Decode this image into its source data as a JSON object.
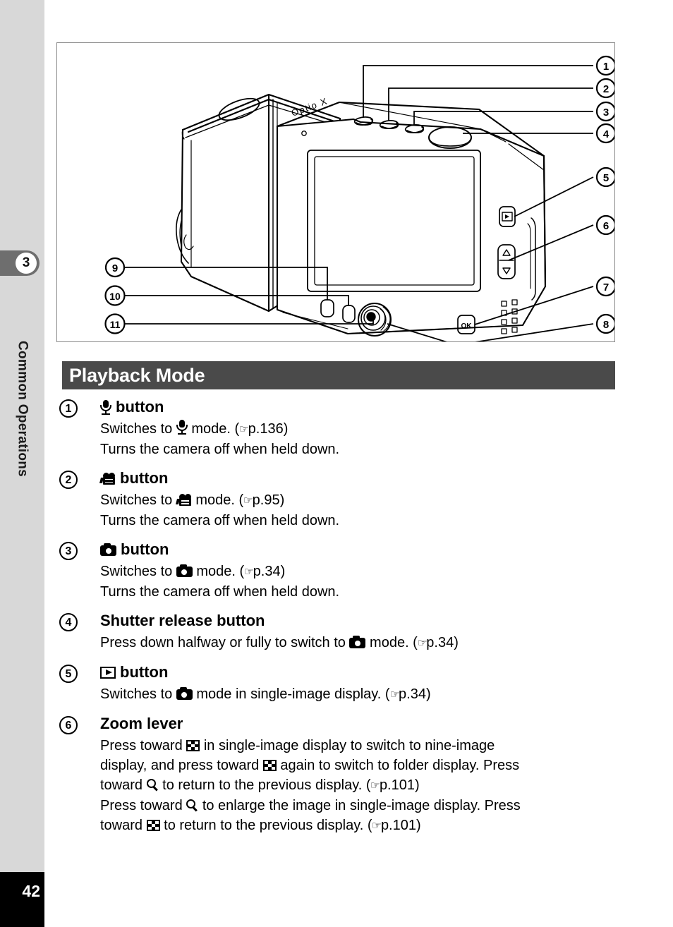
{
  "sidebar": {
    "chapter_number": "3",
    "chapter_title": "Common Operations",
    "page_number": "42"
  },
  "figure": {
    "name": "camera-rear-view-diagram",
    "brand_label": "Optio X",
    "ok_button_label": "OK",
    "callouts_right": [
      "1",
      "2",
      "3",
      "4",
      "5",
      "6",
      "7",
      "8"
    ],
    "callouts_left": [
      "9",
      "10",
      "11"
    ]
  },
  "section": {
    "title": "Playback Mode"
  },
  "items": [
    {
      "marker": "1",
      "icon": "microphone-icon",
      "title_suffix": "button",
      "lines": [
        {
          "parts": [
            {
              "t": "text",
              "v": "Switches to "
            },
            {
              "t": "icon",
              "v": "microphone-icon"
            },
            {
              "t": "text",
              "v": " mode. ("
            },
            {
              "t": "ref",
              "v": "☞"
            },
            {
              "t": "text",
              "v": "p.136)"
            }
          ]
        },
        {
          "parts": [
            {
              "t": "text",
              "v": "Turns the camera off when held down."
            }
          ]
        }
      ]
    },
    {
      "marker": "2",
      "icon": "movie-camera-icon",
      "title_suffix": "button",
      "lines": [
        {
          "parts": [
            {
              "t": "text",
              "v": "Switches to "
            },
            {
              "t": "icon",
              "v": "movie-camera-icon"
            },
            {
              "t": "text",
              "v": " mode. ("
            },
            {
              "t": "ref",
              "v": "☞"
            },
            {
              "t": "text",
              "v": "p.95)"
            }
          ]
        },
        {
          "parts": [
            {
              "t": "text",
              "v": "Turns the camera off when held down."
            }
          ]
        }
      ]
    },
    {
      "marker": "3",
      "icon": "still-camera-icon",
      "title_suffix": "button",
      "lines": [
        {
          "parts": [
            {
              "t": "text",
              "v": "Switches to "
            },
            {
              "t": "icon",
              "v": "still-camera-icon"
            },
            {
              "t": "text",
              "v": " mode. ("
            },
            {
              "t": "ref",
              "v": "☞"
            },
            {
              "t": "text",
              "v": "p.34)"
            }
          ]
        },
        {
          "parts": [
            {
              "t": "text",
              "v": "Turns the camera off when held down."
            }
          ]
        }
      ]
    },
    {
      "marker": "4",
      "icon": null,
      "title_text": "Shutter release button",
      "lines": [
        {
          "parts": [
            {
              "t": "text",
              "v": "Press down halfway or fully to switch to "
            },
            {
              "t": "icon",
              "v": "still-camera-icon"
            },
            {
              "t": "text",
              "v": " mode. ("
            },
            {
              "t": "ref",
              "v": "☞"
            },
            {
              "t": "text",
              "v": "p.34)"
            }
          ]
        }
      ]
    },
    {
      "marker": "5",
      "icon": "playback-icon",
      "title_suffix": "button",
      "lines": [
        {
          "parts": [
            {
              "t": "text",
              "v": "Switches to "
            },
            {
              "t": "icon",
              "v": "still-camera-icon"
            },
            {
              "t": "text",
              "v": " mode in single-image display. ("
            },
            {
              "t": "ref",
              "v": "☞"
            },
            {
              "t": "text",
              "v": "p.34)"
            }
          ]
        }
      ]
    },
    {
      "marker": "6",
      "icon": null,
      "title_text": "Zoom lever",
      "lines": [
        {
          "parts": [
            {
              "t": "text",
              "v": "Press toward "
            },
            {
              "t": "icon",
              "v": "nine-image-icon"
            },
            {
              "t": "text",
              "v": " in single-image display to switch to nine-image"
            }
          ]
        },
        {
          "parts": [
            {
              "t": "text",
              "v": "display, and press toward "
            },
            {
              "t": "icon",
              "v": "nine-image-icon"
            },
            {
              "t": "text",
              "v": " again to switch to folder display. Press"
            }
          ]
        },
        {
          "parts": [
            {
              "t": "text",
              "v": "toward "
            },
            {
              "t": "icon",
              "v": "magnifier-icon"
            },
            {
              "t": "text",
              "v": " to return to the previous display. ("
            },
            {
              "t": "ref",
              "v": "☞"
            },
            {
              "t": "text",
              "v": "p.101)"
            }
          ]
        },
        {
          "parts": [
            {
              "t": "text",
              "v": "Press toward "
            },
            {
              "t": "icon",
              "v": "magnifier-icon"
            },
            {
              "t": "text",
              "v": " to enlarge the image in single-image display. Press"
            }
          ]
        },
        {
          "parts": [
            {
              "t": "text",
              "v": "toward "
            },
            {
              "t": "icon",
              "v": "nine-image-icon"
            },
            {
              "t": "text",
              "v": " to return to the previous display. ("
            },
            {
              "t": "ref",
              "v": "☞"
            },
            {
              "t": "text",
              "v": "p.101)"
            }
          ]
        }
      ]
    }
  ]
}
